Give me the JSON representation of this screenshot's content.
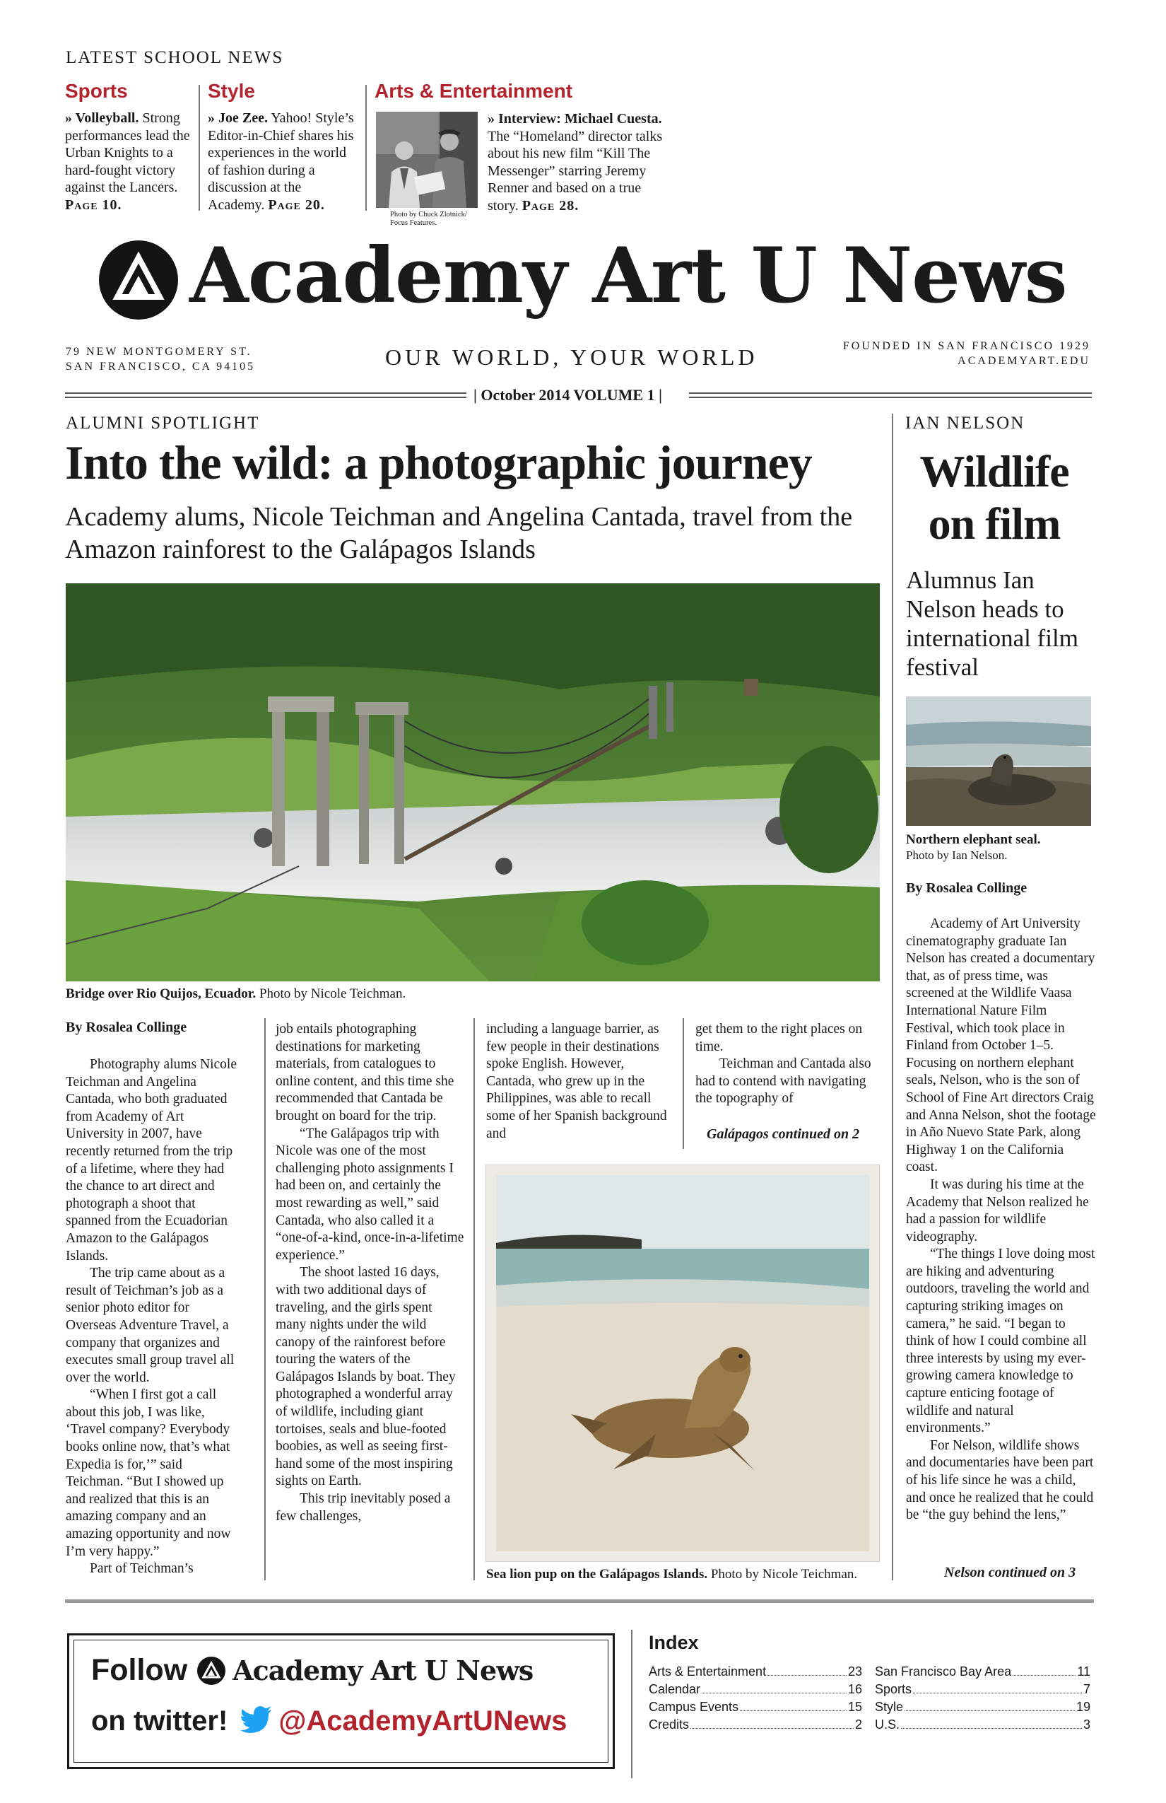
{
  "teasers": {
    "header": "Latest School News",
    "sections": [
      {
        "title": "Sports",
        "lead": "» Volleyball.",
        "text": " Strong performances lead the Urban Knights to a hard-fought victory against the Lancers. ",
        "page": "Page 10."
      },
      {
        "title": "Style",
        "lead": "» Joe Zee.",
        "text": " Yahoo! Style’s Editor-in-Chief shares his experiences in the world of fashion during a discussion at the Academy. ",
        "page": "Page 20."
      },
      {
        "title": "Arts & Entertainment",
        "lead": "» Interview: Michael Cuesta.",
        "text": " The “Homeland” director talks about his new film “Kill The Messenger” starring Jeremy Renner and based on a true story. ",
        "page": "Page 28.",
        "photo_credit": "Photo by Chuck Zlotnick/ Focus Features."
      }
    ]
  },
  "masthead": {
    "title": "Academy Art U News",
    "address_line1": "79 New Montgomery St.",
    "address_line2": "San Francisco, CA 94105",
    "tagline": "Our World, Your World",
    "founded": "Founded in San Francisco 1929",
    "website": "academyart.edu",
    "dateline": "| October 2014 VOLUME 1 |"
  },
  "lead_story": {
    "kicker": "Alumni Spotlight",
    "headline": "Into the wild: a photographic journey",
    "deck": "Academy alums, Nicole Teichman and Angelina Cantada, travel from the Amazon rainforest to the Galápagos Islands",
    "photo_caption_bold": "Bridge over Rio Quijos, Ecuador.",
    "photo_caption_credit": " Photo by Nicole Teichman.",
    "byline": "By Rosalea Collinge",
    "col1": [
      "Photography alums Nicole Teichman and Angelina Cantada, who both graduated from Academy of Art University in 2007, have recently returned from the trip of a lifetime, where they had the chance to art direct and photograph a shoot that spanned from the Ecuadorian Amazon to the Galápagos Islands.",
      "The trip came about as a result of Teichman’s job as a senior photo editor for Overseas Adventure Travel, a company that organizes and executes small group travel all over the world.",
      "“When I first got a call about this job, I was like, ‘Travel company? Everybody books online now, that’s what Expedia is for,’” said Teichman. “But I showed up and realized that this is an amazing company and an amazing opportunity and now I’m very happy.”",
      "Part of Teichman’s"
    ],
    "col2": [
      "job entails photographing destinations for marketing materials, from catalogues to online content, and this time she recommended that Cantada be brought on board for the trip.",
      "“The Galápagos trip with Nicole was one of the most challenging photo assignments I had been on, and certainly the most rewarding as well,” said Cantada, who also called it a “one-of-a-kind, once-in-a-lifetime experience.”",
      "The shoot lasted 16 days, with two additional days of traveling, and the girls spent many nights under the wild canopy of the rainforest before touring the waters of the Galápagos Islands by boat. They photographed a wonderful array of wildlife, including giant tortoises, seals and blue-footed boobies, as well as seeing first-hand some of the most inspiring sights on Earth.",
      "This trip inevitably posed a few challenges,"
    ],
    "col3": [
      "including a language barrier, as few people in their destinations spoke English. However, Cantada, who grew up in the Philippines, was able to recall some of her Spanish background and"
    ],
    "col4": [
      "get them to the right places on time.",
      "Teichman and Cantada also had to contend with navigating the topography of"
    ],
    "jump": "Galápagos continued on 2",
    "photo2_caption_bold": "Sea lion pup on the Galápagos Islands.",
    "photo2_caption_credit": " Photo by Nicole Teichman."
  },
  "side_story": {
    "kicker": "Ian Nelson",
    "headline_line1": "Wildlife",
    "headline_line2": "on film",
    "deck": "Alumnus Ian Nelson heads to international film festival",
    "photo_caption_bold": "Northern elephant seal.",
    "photo_caption_credit": "Photo by Ian Nelson.",
    "byline": "By Rosalea Collinge",
    "paragraphs": [
      "Academy of Art University cinematography graduate Ian Nelson has created a documentary that, as of press time, was screened at the Wildlife Vaasa International Nature Film Festival, which took place in Finland from October 1–5. Focusing on northern elephant seals, Nelson, who is the son of School of Fine Art directors Craig and Anna Nelson, shot the footage in Año Nuevo State Park, along Highway 1 on the California coast.",
      "It was during his time at the Academy that Nelson realized he had a passion for wildlife videography.",
      "“The things I love doing most are hiking and adventuring outdoors, traveling the world and capturing striking images on camera,” he said. “I began to think of how I could combine all three interests by using my ever-growing camera knowledge to capture enticing footage of wildlife and natural environments.”",
      "For Nelson, wildlife shows and documentaries have been part of his life since he was a child, and once he realized that he could be “the guy behind the lens,”"
    ],
    "jump": "Nelson continued on 3"
  },
  "twitter": {
    "follow": "Follow",
    "brand": "Academy Art U News",
    "on_twitter": "on twitter!",
    "handle": "@AcademyArtUNews"
  },
  "index": {
    "title": "Index",
    "left": [
      {
        "label": "Arts & Entertainment",
        "page": "23"
      },
      {
        "label": "Calendar",
        "page": "16"
      },
      {
        "label": "Campus Events",
        "page": "15"
      },
      {
        "label": "Credits",
        "page": "2"
      }
    ],
    "right": [
      {
        "label": "San Francisco Bay Area",
        "page": "11"
      },
      {
        "label": "Sports",
        "page": "7"
      },
      {
        "label": "Style",
        "page": "19"
      },
      {
        "label": "U.S.",
        "page": "3"
      }
    ]
  },
  "colors": {
    "section_red": "#b3232e",
    "twitter_blue": "#1da1f2",
    "ink": "#1a1a1a"
  }
}
